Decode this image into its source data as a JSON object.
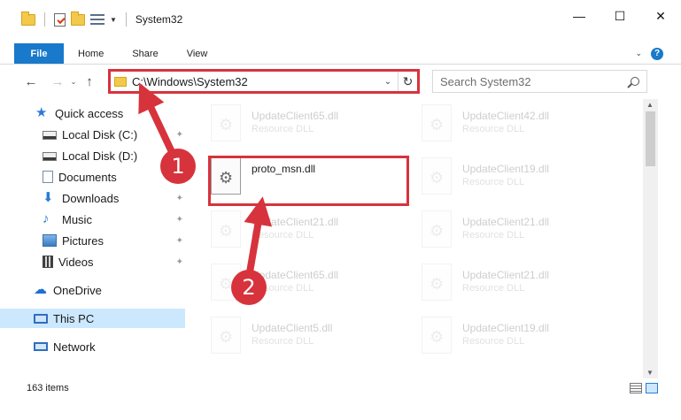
{
  "titlebar": {
    "title": "System32",
    "minimize": "—",
    "maximize": "☐",
    "close": "✕"
  },
  "ribbon": {
    "tabs": [
      "File",
      "Home",
      "Share",
      "View"
    ],
    "expand": "⌄",
    "help": "?"
  },
  "nav": {
    "back": "←",
    "forward": "→",
    "recent": "⌄",
    "up": "↑",
    "address": "C:\\Windows\\System32",
    "address_chevron": "⌄",
    "refresh": "↻",
    "search_placeholder": "Search System32"
  },
  "sidebar": {
    "items": [
      {
        "label": "Quick access",
        "icon": "star-icon",
        "pinned": false
      },
      {
        "label": "Local Disk (C:)",
        "icon": "drive-icon",
        "pinned": true
      },
      {
        "label": "Local Disk (D:)",
        "icon": "drive-icon",
        "pinned": false
      },
      {
        "label": "Documents",
        "icon": "documents-icon",
        "pinned": true
      },
      {
        "label": "Downloads",
        "icon": "download-icon",
        "pinned": true
      },
      {
        "label": "Music",
        "icon": "music-icon",
        "pinned": true
      },
      {
        "label": "Pictures",
        "icon": "pictures-icon",
        "pinned": true
      },
      {
        "label": "Videos",
        "icon": "videos-icon",
        "pinned": true
      },
      {
        "label": "OneDrive",
        "icon": "onedrive-icon",
        "pinned": false
      },
      {
        "label": "This PC",
        "icon": "computer-icon",
        "pinned": false,
        "selected": true
      },
      {
        "label": "Network",
        "icon": "network-icon",
        "pinned": false
      }
    ],
    "pin_glyph": "📌"
  },
  "files": {
    "column_left": [
      {
        "name": "UpdateClient65.dll",
        "type": "Resource DLL"
      },
      {
        "name": "proto_msn.dll",
        "type": ""
      },
      {
        "name": "UpdateClient21.dll",
        "type": "Resource DLL"
      },
      {
        "name": "UpdateClient65.dll",
        "type": "Resource DLL"
      },
      {
        "name": "UpdateClient5.dll",
        "type": "Resource DLL"
      }
    ],
    "column_right": [
      {
        "name": "UpdateClient42.dll",
        "type": "Resource DLL"
      },
      {
        "name": "UpdateClient19.dll",
        "type": "Resource DLL"
      },
      {
        "name": "UpdateClient21.dll",
        "type": "Resource DLL"
      },
      {
        "name": "UpdateClient21.dll",
        "type": "Resource DLL"
      },
      {
        "name": "UpdateClient19.dll",
        "type": "Resource DLL"
      }
    ]
  },
  "status": {
    "item_count": "163 items"
  },
  "annotations": {
    "callout_1": "1",
    "callout_2": "2",
    "color": "#d7333c"
  },
  "colors": {
    "accent": "#1979ca",
    "selection": "#cce8ff",
    "highlight": "#d7333c"
  }
}
